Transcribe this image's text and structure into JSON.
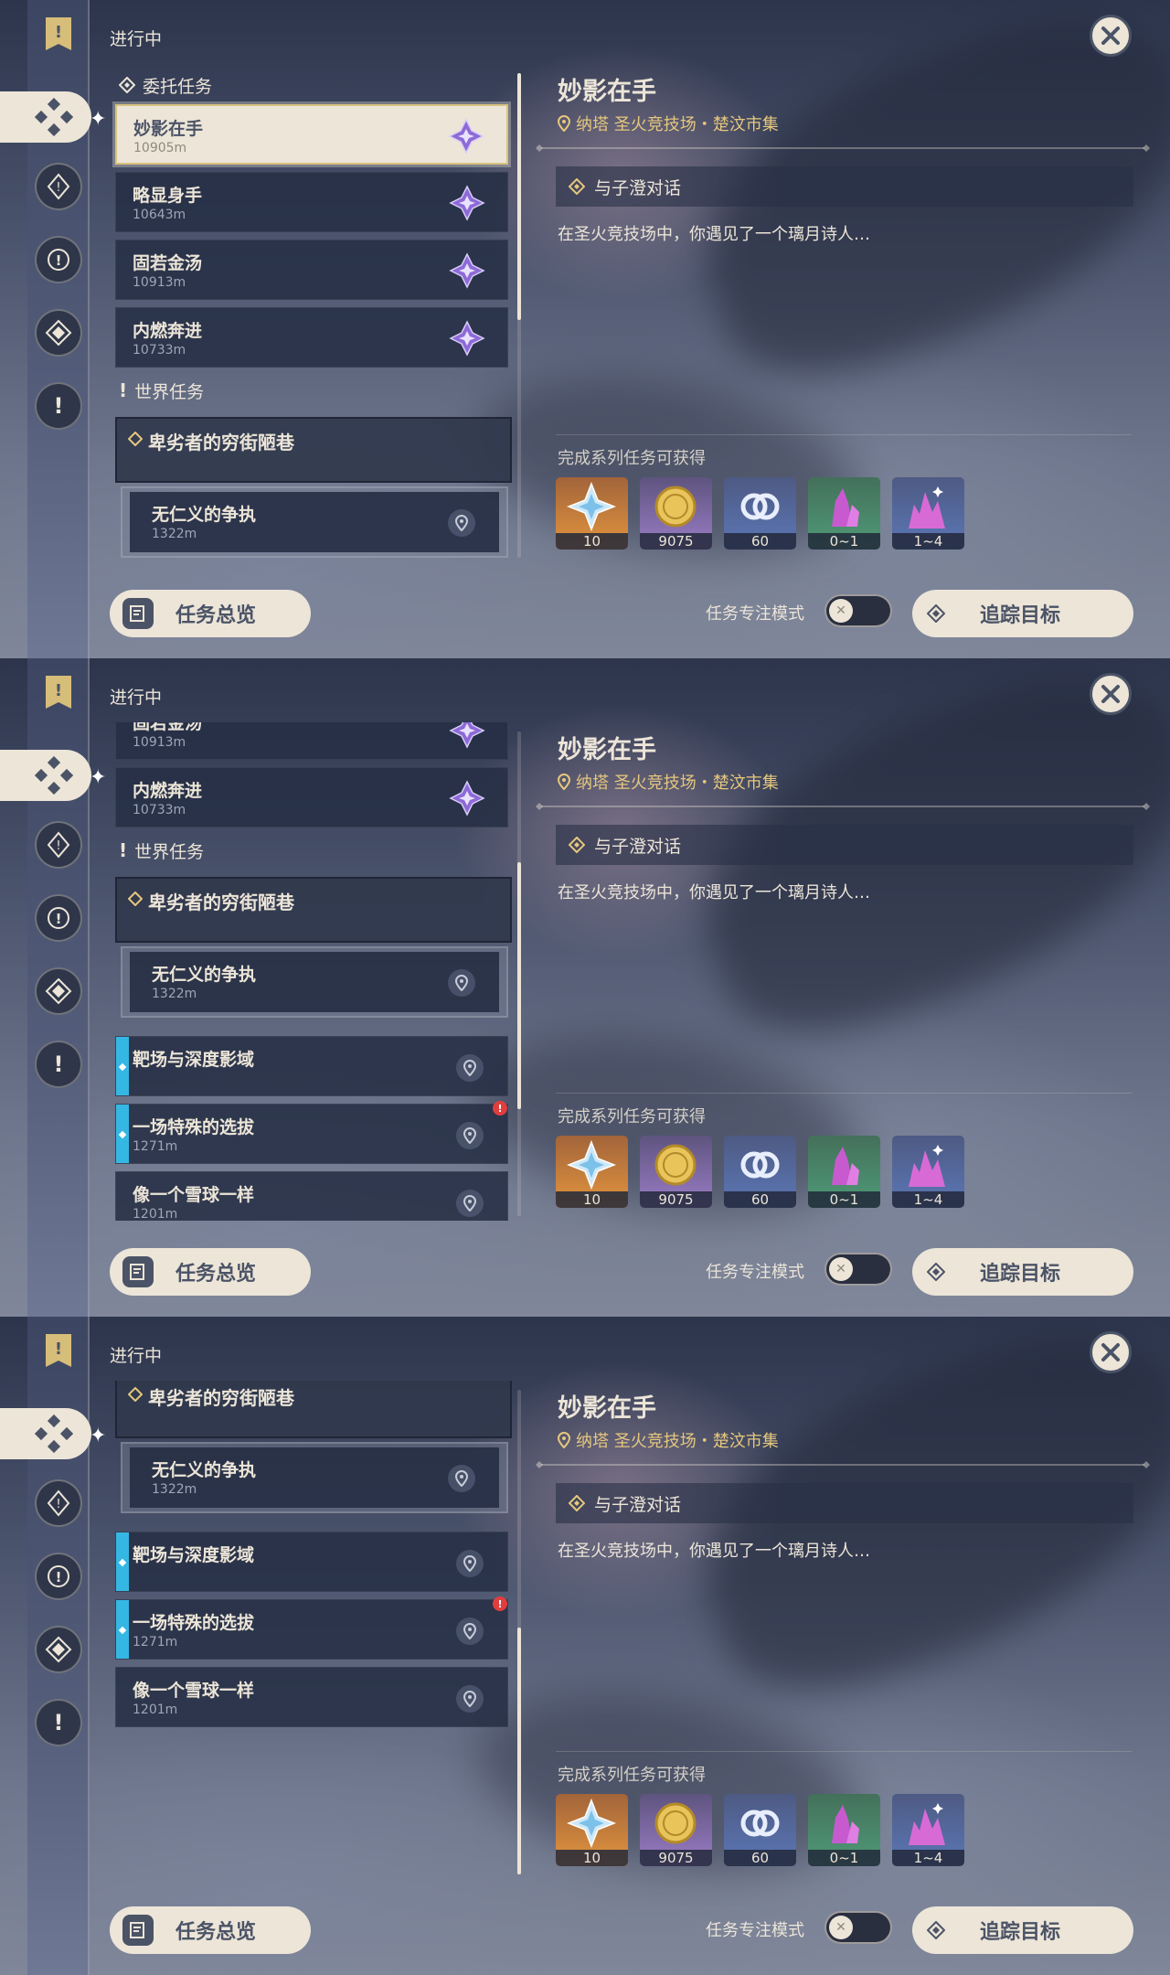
{
  "status_label": "进行中",
  "sections": {
    "commission": "委托任务",
    "world": "世界任务"
  },
  "commission_quests": [
    {
      "title": "妙影在手",
      "distance": "10905m"
    },
    {
      "title": "略显身手",
      "distance": "10643m"
    },
    {
      "title": "固若金汤",
      "distance": "10913m"
    },
    {
      "title": "内燃奔进",
      "distance": "10733m"
    }
  ],
  "world_group": {
    "title": "卑劣者的穷街陋巷",
    "sub_quest": {
      "title": "无仁义的争执",
      "distance": "1322m"
    }
  },
  "world_quests": [
    {
      "title": "靶场与深度影域",
      "distance": ""
    },
    {
      "title": "一场特殊的选拔",
      "distance": "1271m"
    },
    {
      "title": "像一个雪球一样",
      "distance": "1201m"
    }
  ],
  "overview_button": "任务总览",
  "detail": {
    "title": "妙影在手",
    "location": "纳塔 圣火竞技场・楚汶市集",
    "objective": "与子澄对话",
    "description": "在圣火竞技场中，你遇见了一个璃月诗人…",
    "rewards_label": "完成系列任务可获得",
    "rewards": [
      {
        "icon": "primogem-icon",
        "count": "10"
      },
      {
        "icon": "mora-icon",
        "count": "9075"
      },
      {
        "icon": "friendship-exp-icon",
        "count": "60"
      },
      {
        "icon": "crystal-chunk-icon",
        "count": "0~1"
      },
      {
        "icon": "crystal-cluster-icon",
        "count": "1~4"
      }
    ]
  },
  "focus_mode_label": "任务专注模式",
  "focus_mode_on": false,
  "track_button": "追踪目标",
  "colors": {
    "accent_cream": "#ece5d8",
    "location_gold": "#e6c77e",
    "world_quest_bar": "#35b7e3",
    "alert_red": "#e03e3e"
  },
  "screens": [
    {
      "view": "list-top",
      "scroll_fraction": 0.0
    },
    {
      "view": "list-middle",
      "scroll_fraction": 0.55
    },
    {
      "view": "list-bottom",
      "scroll_fraction": 1.0
    }
  ]
}
